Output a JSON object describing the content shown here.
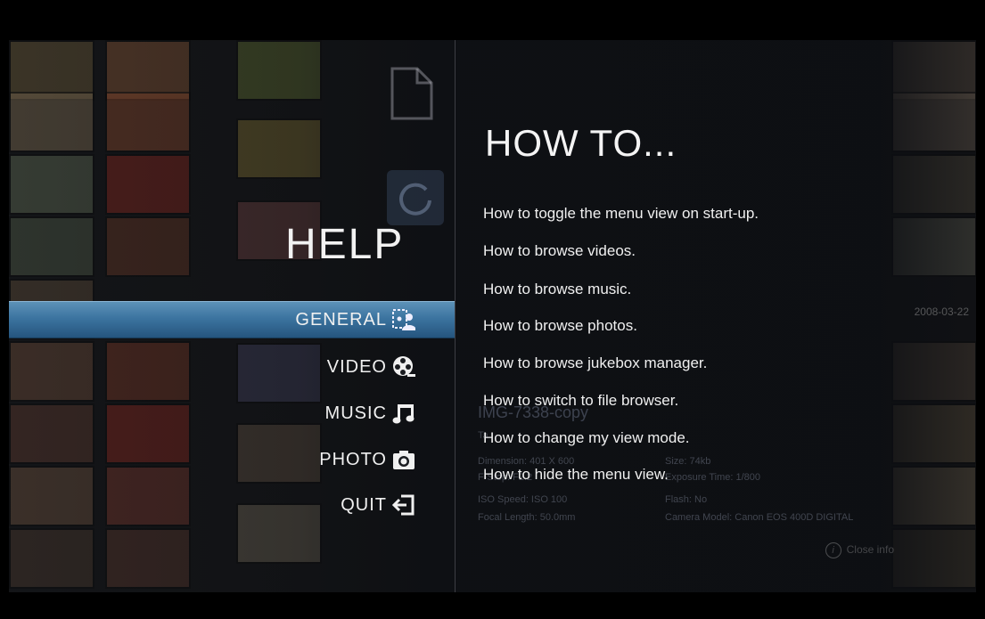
{
  "help": {
    "title": "HELP"
  },
  "menu": [
    {
      "id": "general",
      "label": "GENERAL",
      "icon": "general-icon",
      "active": true
    },
    {
      "id": "video",
      "label": "VIDEO",
      "icon": "film-reel-icon",
      "active": false
    },
    {
      "id": "music",
      "label": "MUSIC",
      "icon": "music-note-icon",
      "active": false
    },
    {
      "id": "photo",
      "label": "PHOTO",
      "icon": "camera-icon",
      "active": false
    },
    {
      "id": "quit",
      "label": "QUIT",
      "icon": "exit-icon",
      "active": false
    }
  ],
  "howto": {
    "title": "HOW TO...",
    "items": [
      "How to toggle the menu view on start-up.",
      "How to browse videos.",
      "How to browse music.",
      "How to browse photos.",
      "How to browse jukebox manager.",
      "How to switch to file browser.",
      "How to change my view mode.",
      "How to hide the menu view."
    ]
  },
  "background_info": {
    "filename": "IMG-7338-copy",
    "tag_prefix": "Ta",
    "dimension": "Dimension: 401 X 600",
    "size": "Size: 74kb",
    "fstop": "F-Stop: F2.2",
    "exposure": "Exposure Time: 1/800",
    "iso": "ISO Speed: ISO 100",
    "flash": "Flash: No",
    "focal": "Focal Length: 50.0mm",
    "camera": "Camera Model: Canon EOS 400D DIGITAL",
    "close_info": "Close info",
    "date": "2008-03-22"
  },
  "colors": {
    "accent_active": "#3c74a0",
    "text": "#f0f0f0"
  }
}
